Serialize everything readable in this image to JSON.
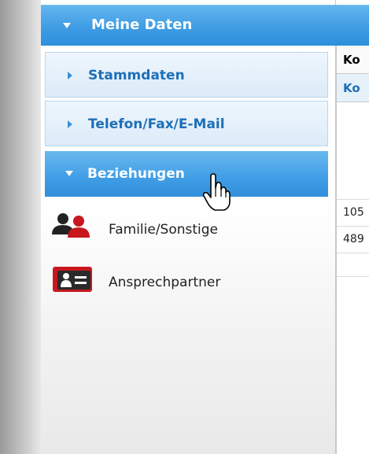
{
  "header": {
    "title": "Meine Daten"
  },
  "sections": [
    {
      "label": "Stammdaten"
    },
    {
      "label": "Telefon/Fax/E-Mail"
    },
    {
      "label": "Beziehungen"
    }
  ],
  "items": [
    {
      "label": "Familie/Sonstige",
      "icon": "family-icon"
    },
    {
      "label": "Ansprechpartner",
      "icon": "contact-card-icon"
    }
  ],
  "table": {
    "headers": [
      "Ko",
      "Ko"
    ],
    "rows": [
      "",
      "105",
      "489",
      ""
    ]
  },
  "colors": {
    "accent": "#3f9de5",
    "section_text": "#1e6fb8",
    "icon_red": "#c8171e"
  }
}
